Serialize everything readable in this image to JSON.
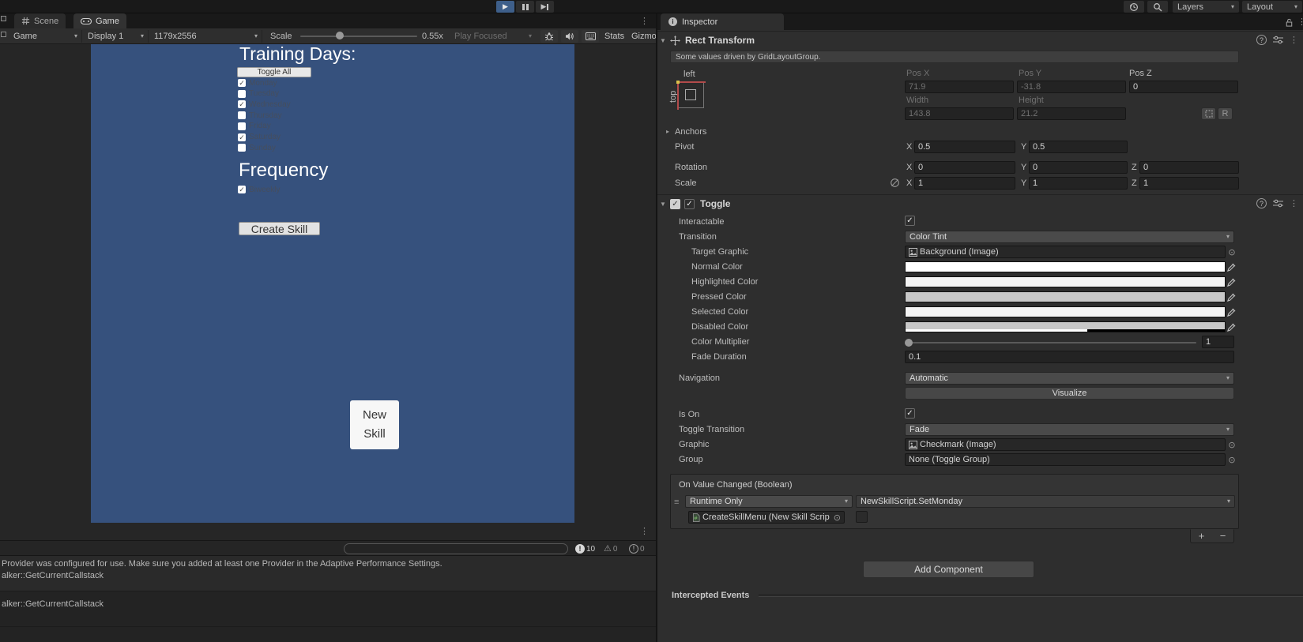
{
  "icons": {
    "more": "⋮",
    "dropdown_arrow": "▾",
    "check": "✓",
    "picker": "⊙",
    "warning": "⚠",
    "drag_handle": "≡",
    "foldout_open": "▼",
    "foldout_closed": "▸",
    "help": "?",
    "plus": "+",
    "minus": "−",
    "info": "!",
    "error": "!",
    "play": "▶"
  },
  "topbar": {
    "layers_label": "Layers",
    "layout_label": "Layout"
  },
  "game_panel": {
    "tabs": {
      "scene": "Scene",
      "game": "Game"
    },
    "toolbar": {
      "game_dropdown": "Game",
      "display_dropdown": "Display 1",
      "resolution_dropdown": "1179x2556",
      "scale_label": "Scale",
      "scale_value": "0.55x",
      "play_focused": "Play Focused",
      "stats_label": "Stats",
      "gizmos_label": "Gizmos"
    },
    "game_view": {
      "title": "Training Days:",
      "toggle_all_label": "Toggle All",
      "days": [
        {
          "label": "Monday",
          "checked": true
        },
        {
          "label": "Tuesday",
          "checked": false
        },
        {
          "label": "Wednesday",
          "checked": true
        },
        {
          "label": "Thursday",
          "checked": false
        },
        {
          "label": "Friday",
          "checked": false
        },
        {
          "label": "Saturday",
          "checked": true
        },
        {
          "label": "Sunday",
          "checked": false
        }
      ],
      "frequency_heading": "Frequency",
      "biweekly": {
        "label": "Biweekly",
        "checked": true
      },
      "create_skill_label": "Create Skill",
      "new_skill_line1": "New",
      "new_skill_line2": "Skill"
    }
  },
  "console": {
    "info_count": "10",
    "warning_count": "0",
    "error_count": "0",
    "entries": [
      {
        "lines": [
          "Provider was configured for use. Make sure you added at least one Provider in the Adaptive Performance Settings.",
          "alker::GetCurrentCallstack"
        ]
      },
      {
        "lines": [
          "alker::GetCurrentCallstack"
        ]
      }
    ]
  },
  "inspector": {
    "tab_label": "Inspector",
    "axis": {
      "x": "X",
      "y": "Y",
      "z": "Z"
    },
    "rect_transform": {
      "title": "Rect Transform",
      "helpbox": "Some values driven by GridLayoutGroup.",
      "anchor_horizontal": "left",
      "anchor_vertical": "top",
      "pos_x_label": "Pos X",
      "pos_y_label": "Pos Y",
      "pos_z_label": "Pos Z",
      "pos_x": "71.9",
      "pos_y": "-31.8",
      "pos_z": "0",
      "width_label": "Width",
      "height_label": "Height",
      "width": "143.8",
      "height": "21.2",
      "raw_button": "R",
      "anchors_label": "Anchors",
      "pivot_label": "Pivot",
      "pivot_x": "0.5",
      "pivot_y": "0.5",
      "rotation_label": "Rotation",
      "rotation_x": "0",
      "rotation_y": "0",
      "rotation_z": "0",
      "scale_label": "Scale",
      "scale_x": "1",
      "scale_y": "1",
      "scale_z": "1"
    },
    "toggle": {
      "title": "Toggle",
      "interactable_label": "Interactable",
      "interactable_checked": true,
      "transition_label": "Transition",
      "transition_value": "Color Tint",
      "target_graphic_label": "Target Graphic",
      "target_graphic_value": "Background (Image)",
      "normal_color_label": "Normal Color",
      "normal_color": "#FFFFFF",
      "highlighted_color_label": "Highlighted Color",
      "highlighted_color": "#F4F4F4",
      "pressed_color_label": "Pressed Color",
      "pressed_color": "#C8C8C8",
      "selected_color_label": "Selected Color",
      "selected_color": "#F4F4F4",
      "disabled_color_label": "Disabled Color",
      "disabled_color": "#C8C8C8",
      "color_multiplier_label": "Color Multiplier",
      "color_multiplier": "1",
      "fade_duration_label": "Fade Duration",
      "fade_duration": "0.1",
      "navigation_label": "Navigation",
      "navigation_value": "Automatic",
      "visualize_label": "Visualize",
      "is_on_label": "Is On",
      "is_on_checked": true,
      "toggle_transition_label": "Toggle Transition",
      "toggle_transition_value": "Fade",
      "graphic_label": "Graphic",
      "graphic_value": "Checkmark (Image)",
      "group_label": "Group",
      "group_value": "None (Toggle Group)",
      "event": {
        "title": "On Value Changed (Boolean)",
        "mode": "Runtime Only",
        "function": "NewSkillScript.SetMonday",
        "target": "CreateSkillMenu (New Skill Scrip"
      }
    },
    "add_component_label": "Add Component",
    "intercepted_events_label": "Intercepted Events"
  }
}
